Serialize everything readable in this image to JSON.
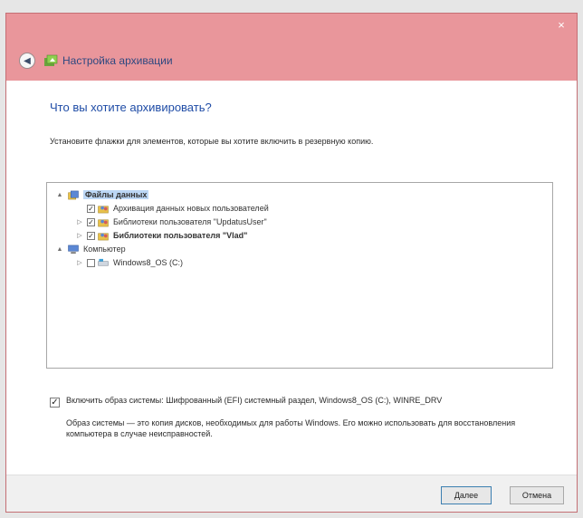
{
  "window": {
    "title": "Настройка архивации",
    "close_glyph": "×",
    "accent_color": "#e9969b"
  },
  "page": {
    "heading": "Что вы хотите архивировать?",
    "instruction": "Установите флажки для элементов, которые вы хотите включить в резервную копию."
  },
  "tree": {
    "items": [
      {
        "label": "Файлы данных",
        "level": 0,
        "expander": "▲",
        "checked": null,
        "icon": "files-icon",
        "bold": true,
        "selected": true
      },
      {
        "label": "Архивация данных новых пользователей",
        "level": 1,
        "expander": "",
        "checked": true,
        "icon": "users-folder-icon",
        "bold": false,
        "selected": false
      },
      {
        "label": "Библиотеки пользователя \"UpdatusUser\"",
        "level": 1,
        "expander": "▷",
        "checked": true,
        "icon": "users-folder-icon",
        "bold": false,
        "selected": false
      },
      {
        "label": "Библиотеки пользователя \"Vlad\"",
        "level": 1,
        "expander": "▷",
        "checked": true,
        "icon": "users-folder-icon",
        "bold": true,
        "selected": false
      },
      {
        "label": "Компьютер",
        "level": 0,
        "expander": "▲",
        "checked": null,
        "icon": "computer-icon",
        "bold": false,
        "selected": false
      },
      {
        "label": "Windows8_OS (C:)",
        "level": 1,
        "expander": "▷",
        "checked": false,
        "icon": "drive-icon",
        "bold": false,
        "selected": false
      }
    ]
  },
  "system_image": {
    "checked": true,
    "label": "Включить образ системы: Шифрованный (EFI) системный раздел, Windows8_OS (C:), WINRE_DRV",
    "description": "Образ системы — это копия дисков, необходимых для работы Windows. Его можно использовать для восстановления компьютера в случае неисправностей."
  },
  "footer": {
    "next_label": "Далее",
    "cancel_label": "Отмена"
  }
}
